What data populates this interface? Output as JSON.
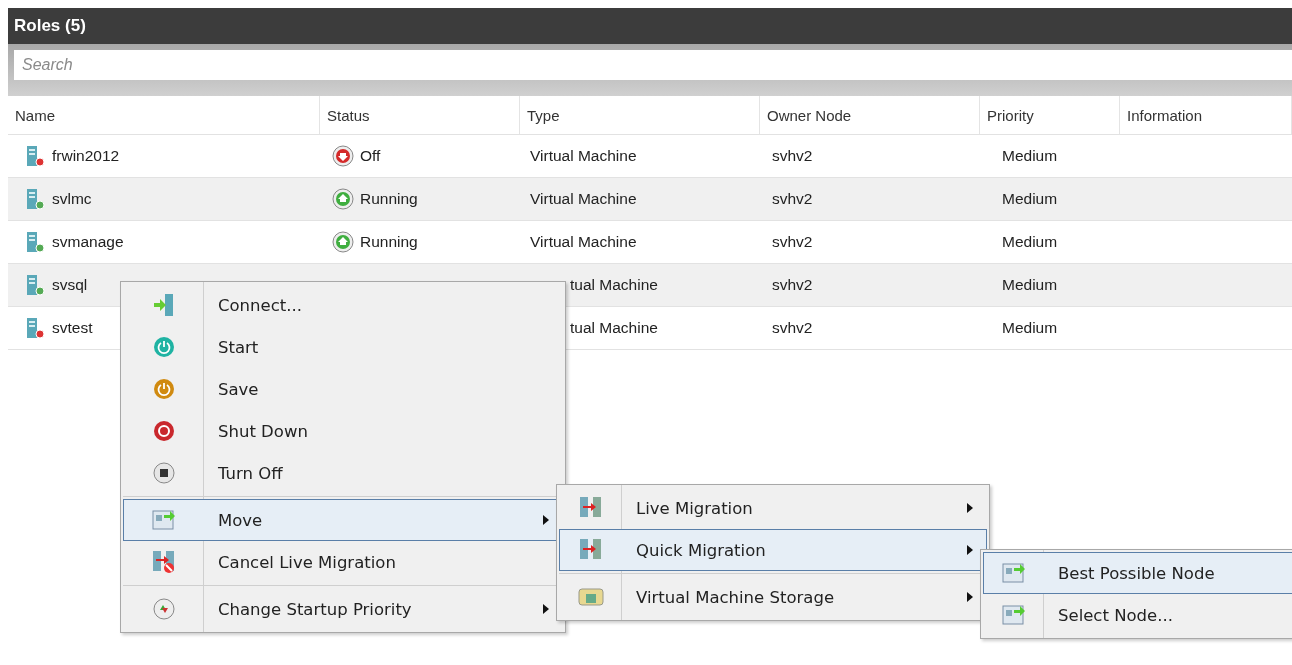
{
  "panel": {
    "title": "Roles (5)"
  },
  "search": {
    "placeholder": "Search"
  },
  "table": {
    "columns": [
      "Name",
      "Status",
      "Type",
      "Owner Node",
      "Priority",
      "Information"
    ],
    "rows": [
      {
        "name": "frwin2012",
        "kind": "off",
        "status": "Off",
        "type": "Virtual Machine",
        "owner": "svhv2",
        "priority": "Medium"
      },
      {
        "name": "svlmc",
        "kind": "running",
        "status": "Running",
        "type": "Virtual Machine",
        "owner": "svhv2",
        "priority": "Medium"
      },
      {
        "name": "svmanage",
        "kind": "running",
        "status": "Running",
        "type": "Virtual Machine",
        "owner": "svhv2",
        "priority": "Medium"
      },
      {
        "name": "svsql",
        "kind": "running",
        "type": "tual Machine",
        "owner": "svhv2",
        "priority": "Medium"
      },
      {
        "name": "svtest",
        "kind": "off",
        "type": "tual Machine",
        "owner": "svhv2",
        "priority": "Medium"
      }
    ]
  },
  "context_menu": {
    "groups": [
      [
        {
          "label": "Connect...",
          "kind": "connect",
          "submenu": false,
          "selected": false
        },
        {
          "label": "Start",
          "kind": "start",
          "submenu": false,
          "selected": false
        },
        {
          "label": "Save",
          "kind": "save",
          "submenu": false,
          "selected": false
        },
        {
          "label": "Shut Down",
          "kind": "shutdown",
          "submenu": false,
          "selected": false
        },
        {
          "label": "Turn Off",
          "kind": "turnoff",
          "submenu": false,
          "selected": false
        }
      ],
      [
        {
          "label": "Move",
          "kind": "move",
          "submenu": true,
          "selected": true
        },
        {
          "label": "Cancel Live Migration",
          "kind": "cancel",
          "submenu": false,
          "selected": false
        }
      ],
      [
        {
          "label": "Change Startup Priority",
          "kind": "priority",
          "submenu": true,
          "selected": false
        }
      ]
    ]
  },
  "move_submenu": {
    "groups": [
      [
        {
          "label": "Live Migration",
          "kind": "migrate",
          "submenu": true,
          "selected": false
        },
        {
          "label": "Quick Migration",
          "kind": "migrate",
          "submenu": true,
          "selected": true
        }
      ],
      [
        {
          "label": "Virtual Machine Storage",
          "kind": "storage",
          "submenu": true,
          "selected": false
        }
      ]
    ]
  },
  "quick_submenu": {
    "groups": [
      [
        {
          "label": "Best Possible Node",
          "kind": "move",
          "submenu": false,
          "selected": true
        },
        {
          "label": "Select Node...",
          "kind": "move",
          "submenu": false,
          "selected": false
        }
      ]
    ]
  }
}
